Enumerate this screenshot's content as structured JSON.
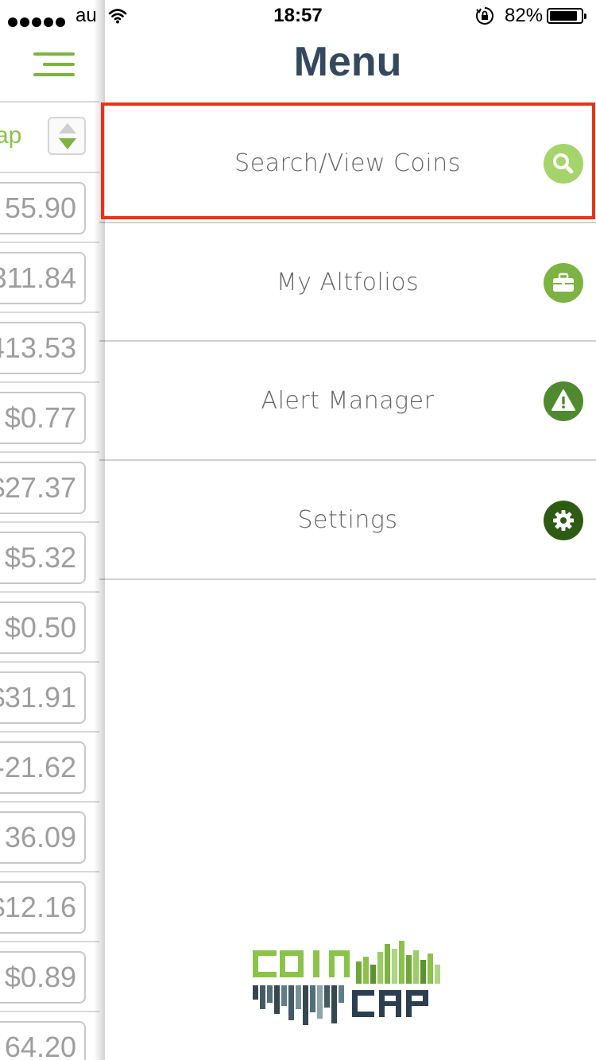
{
  "status_bar": {
    "carrier": "au",
    "time": "18:57",
    "battery_percent": "82%",
    "signal_icon": "signal-dots-icon",
    "wifi_icon": "wifi-icon",
    "lock_icon": "orientation-lock-icon"
  },
  "background_app": {
    "sort_label": "ap",
    "prices": [
      "55.90",
      "311.84",
      "413.53",
      "$0.77",
      "$27.37",
      "$5.32",
      "$0.50",
      "$31.91",
      "-21.62",
      "36.09",
      "$12.16",
      "$0.89",
      "64.20"
    ]
  },
  "menu": {
    "title": "Menu",
    "items": [
      {
        "label": "Search/View Coins",
        "icon": "search-icon",
        "color": "#a5d46a"
      },
      {
        "label": "My Altfolios",
        "icon": "briefcase-icon",
        "color": "#7cb342"
      },
      {
        "label": "Alert Manager",
        "icon": "warning-icon",
        "color": "#4f8a2e"
      },
      {
        "label": "Settings",
        "icon": "gear-icon",
        "color": "#2e5b13"
      }
    ]
  },
  "logo": {
    "line1": "COIN",
    "line2": "CAP"
  },
  "colors": {
    "accent": "#7cb342",
    "title": "#34495e",
    "highlight": "#f03012"
  }
}
